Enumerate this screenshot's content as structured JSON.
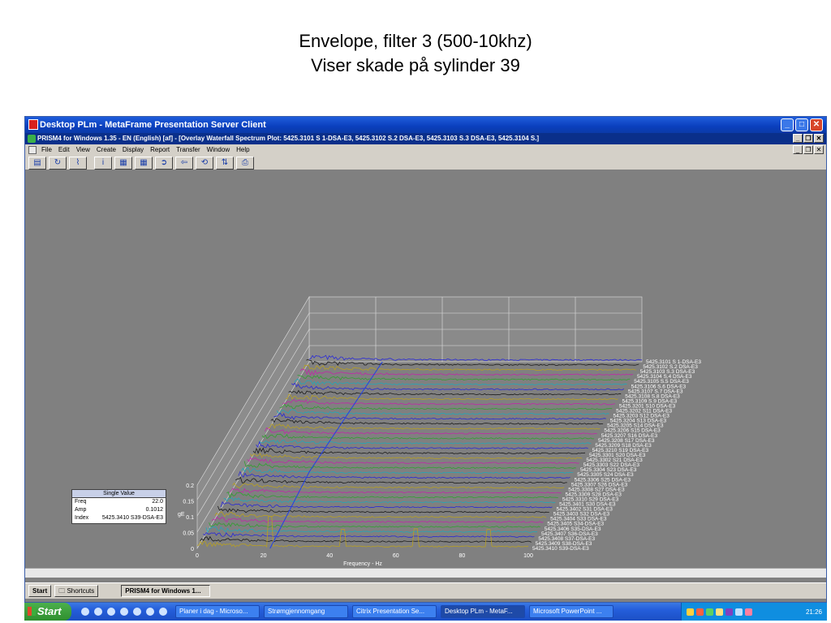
{
  "slide": {
    "title_line1": "Envelope, filter 3 (500-10khz)",
    "title_line2": "Viser skade på sylinder 39"
  },
  "citrix_window": {
    "title": "Desktop PLm - MetaFrame Presentation Server Client"
  },
  "prism_window": {
    "title": "PRISM4 for Windows 1.35 - EN (English) [af] - [Overlay Waterfall Spectrum Plot: 5425.3101 S 1-DSA-E3, 5425.3102 S.2 DSA-E3, 5425.3103 S.3 DSA-E3, 5425.3104 S.]"
  },
  "menu": [
    "File",
    "Edit",
    "View",
    "Create",
    "Display",
    "Report",
    "Transfer",
    "Window",
    "Help"
  ],
  "toolbar_icons": [
    "chart-icon",
    "refresh-icon",
    "filter-icon",
    "info-icon",
    "waterfall-icon",
    "waterfall-color-icon",
    "forward-icon",
    "back-icon",
    "cycle-icon",
    "swap-icon",
    "print-icon"
  ],
  "chart_data": {
    "type": "line",
    "chart_kind": "waterfall",
    "xlabel": "Frequency - Hz",
    "ylabel": "gE",
    "xlim": [
      0,
      100
    ],
    "x_ticks": [
      "0",
      "20",
      "40",
      "60",
      "80",
      "100"
    ],
    "ylim": [
      0,
      0.2
    ],
    "y_ticks": [
      "0",
      "0.05",
      "0.1",
      "0.15",
      "0.2"
    ],
    "grid": true,
    "series_colors": [
      "#2828d8",
      "#1a1a1a",
      "#b8a020",
      "#c028a8",
      "#30a030",
      "#20a8b8"
    ],
    "series": [
      {
        "name": "5425.3101 S 1-DSA-E3"
      },
      {
        "name": "5425.3102 S.2 DSA-E3"
      },
      {
        "name": "5425.3103 S.3 DSA-E3"
      },
      {
        "name": "5425.3104 S.4 DSA-E3"
      },
      {
        "name": "5425.3105 S.5 DSA-E3"
      },
      {
        "name": "5425.3106 S.6 DSA-E3"
      },
      {
        "name": "5425.3107 S.7 DSA-E3"
      },
      {
        "name": "5425.3108 S.8 DSA-E3"
      },
      {
        "name": "5425.3109 S.9 DSA-E3"
      },
      {
        "name": "5425.3201 S10 DSA-E3"
      },
      {
        "name": "5425.3202 S11 DSA-E3"
      },
      {
        "name": "5425.3203 S12 DSA-E3"
      },
      {
        "name": "5425.3204 S13 DSA-E3"
      },
      {
        "name": "5425.3205 S14 DSA-E3"
      },
      {
        "name": "5425.3206 S15 DSA-E3"
      },
      {
        "name": "5425.3207 S16 DSA-E3"
      },
      {
        "name": "5425.3208 S17 DSA-E3"
      },
      {
        "name": "5425.3209 S18 DSA-E3"
      },
      {
        "name": "5425.3210 S19 DSA-E3"
      },
      {
        "name": "5425.3301 S20 DSA-E3"
      },
      {
        "name": "5425.3302 S21 DSA-E3"
      },
      {
        "name": "5425.3303 S22 DSA-E3"
      },
      {
        "name": "5425.3304 S23 DSA-E3"
      },
      {
        "name": "5425.3305 S24 DSA-E3"
      },
      {
        "name": "5425.3306 S25 DSA-E3"
      },
      {
        "name": "5425.3307 S26 DSA-E3"
      },
      {
        "name": "5425.3308 S27 DSA-E3"
      },
      {
        "name": "5425.3309 S28 DSA-E3"
      },
      {
        "name": "5425.3310 S29 DSA-E3"
      },
      {
        "name": "5425.3401 S30 DSA-E3"
      },
      {
        "name": "5425.3402 S31 DSA-E3"
      },
      {
        "name": "5425.3403 S32 DSA-E3"
      },
      {
        "name": "5425.3404 S33 DSA-E3"
      },
      {
        "name": "5425.3405 S34-DSA-E3"
      },
      {
        "name": "5425.3406 S35-DSA-E3"
      },
      {
        "name": "5425.3407 S36-DSA-E3"
      },
      {
        "name": "5425.3408 S37-DSA-E3"
      },
      {
        "name": "5425.3409 S38-DSA-E3"
      },
      {
        "name": "5425.3410 S39-DSA-E3"
      }
    ]
  },
  "single_value": {
    "heading": "Single Value",
    "freq_label": "Freq",
    "freq_value": "22.0",
    "amp_label": "Amp",
    "amp_value": "0.1012",
    "index_label": "Index",
    "index_value": "5425.3410 S39-DSA-E3"
  },
  "inner_taskbar": {
    "start": "Start",
    "shortcuts": "Shortcuts",
    "prism_task": "PRISM4 for Windows 1..."
  },
  "xp_taskbar": {
    "start": "Start",
    "tasks": [
      "Planer i dag - Microso...",
      "Strømgjennomgang",
      "Citrix Presentation Se...",
      "Desktop PLm - MetaF...",
      "Microsoft PowerPoint ..."
    ],
    "clock": "21:26"
  }
}
